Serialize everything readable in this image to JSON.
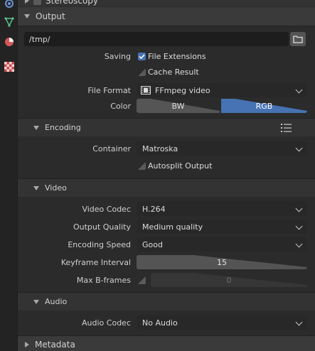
{
  "sections": {
    "stereoscopy": "Stereoscopy",
    "output": "Output",
    "encoding": "Encoding",
    "video": "Video",
    "audio": "Audio",
    "metadata": "Metadata"
  },
  "output": {
    "path": "/tmp/",
    "saving_label": "Saving",
    "file_extensions_label": "File Extensions",
    "file_extensions_checked": true,
    "cache_result_label": "Cache Result",
    "cache_result_checked": false,
    "file_format_label": "File Format",
    "file_format_value": "FFmpeg video",
    "color_label": "Color",
    "color_options": [
      "BW",
      "RGB"
    ],
    "color_selected": "RGB"
  },
  "encoding": {
    "container_label": "Container",
    "container_value": "Matroska",
    "autosplit_label": "Autosplit Output",
    "autosplit_checked": false
  },
  "video": {
    "codec_label": "Video Codec",
    "codec_value": "H.264",
    "quality_label": "Output Quality",
    "quality_value": "Medium quality",
    "speed_label": "Encoding Speed",
    "speed_value": "Good",
    "keyframe_label": "Keyframe Interval",
    "keyframe_value": "15",
    "bframes_label": "Max B-frames",
    "bframes_value": "0",
    "bframes_enabled": false
  },
  "audio": {
    "codec_label": "Audio Codec",
    "codec_value": "No Audio"
  },
  "colors": {
    "accent": "#4772b3",
    "panel_bg": "#2b2b2b",
    "field_bg": "#282828"
  }
}
